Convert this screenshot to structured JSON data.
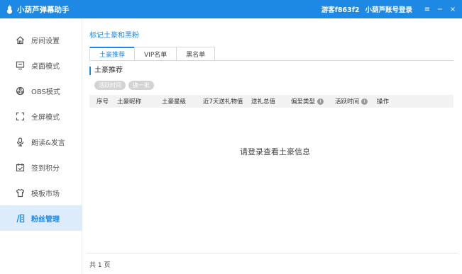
{
  "titlebar": {
    "app_title": "小葫芦弹幕助手",
    "guest": "游客f863f2",
    "login": "小葫芦账号登录",
    "menu_glyph": "≡",
    "min_glyph": "−",
    "close_glyph": "×"
  },
  "sidebar": {
    "items": [
      {
        "label": "房间设置",
        "icon": "home-icon"
      },
      {
        "label": "桌面模式",
        "icon": "monitor-icon"
      },
      {
        "label": "OBS模式",
        "icon": "obs-icon"
      },
      {
        "label": "全屏模式",
        "icon": "fullscreen-icon"
      },
      {
        "label": "朗读&发言",
        "icon": "microphone-icon"
      },
      {
        "label": "签到积分",
        "icon": "calendar-check-icon"
      },
      {
        "label": "模板市场",
        "icon": "shirt-icon"
      },
      {
        "label": "粉丝管理",
        "icon": "fan-manage-icon"
      }
    ],
    "active_index": 7
  },
  "main": {
    "page_title": "标记土豪和黑粉",
    "tabs": [
      "土豪推荐",
      "VIP名单",
      "黑名单"
    ],
    "active_tab": 0,
    "section_title": "土豪推荐",
    "buttons": [
      "活跃时间",
      "换一批"
    ],
    "columns": [
      "序号",
      "土豪昵称",
      "土豪星级",
      "近7天送礼物值",
      "送礼总值",
      "偏爱类型",
      "活跃时间",
      "操作"
    ],
    "empty_message": "请登录查看土豪信息",
    "pager": "共 1 页"
  },
  "colors": {
    "accent": "#1e88e5",
    "active_bg": "#dcecfa"
  }
}
